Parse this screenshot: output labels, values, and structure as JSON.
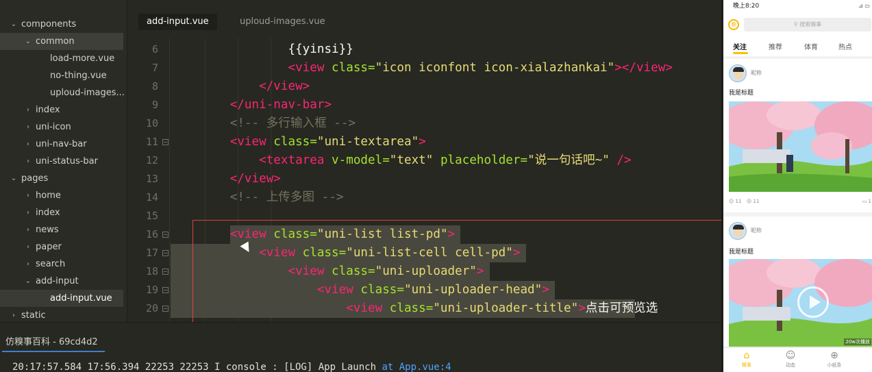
{
  "sidebar": {
    "items": [
      {
        "label": "components",
        "level": 0,
        "expanded": true
      },
      {
        "label": "common",
        "level": 1,
        "expanded": true,
        "highlighted": true
      },
      {
        "label": "load-more.vue",
        "level": 2,
        "file": true
      },
      {
        "label": "no-thing.vue",
        "level": 2,
        "file": true
      },
      {
        "label": "uploud-images...",
        "level": 2,
        "file": true
      },
      {
        "label": "index",
        "level": 1,
        "expanded": false
      },
      {
        "label": "uni-icon",
        "level": 1,
        "expanded": false
      },
      {
        "label": "uni-nav-bar",
        "level": 1,
        "expanded": false
      },
      {
        "label": "uni-status-bar",
        "level": 1,
        "expanded": false
      },
      {
        "label": "pages",
        "level": 0,
        "expanded": true
      },
      {
        "label": "home",
        "level": 1,
        "expanded": false
      },
      {
        "label": "index",
        "level": 1,
        "expanded": false
      },
      {
        "label": "news",
        "level": 1,
        "expanded": false
      },
      {
        "label": "paper",
        "level": 1,
        "expanded": false
      },
      {
        "label": "search",
        "level": 1,
        "expanded": false
      },
      {
        "label": "add-input",
        "level": 1,
        "expanded": true
      },
      {
        "label": "add-input.vue",
        "level": 2,
        "file": true,
        "current": true
      },
      {
        "label": "static",
        "level": 0,
        "expanded": false
      }
    ]
  },
  "tabs": [
    {
      "label": "add-input.vue",
      "active": true
    },
    {
      "label": "uploud-images.vue",
      "active": false
    }
  ],
  "editor": {
    "lines": [
      {
        "num": "6",
        "fold": false,
        "tokens": [
          {
            "t": "txt",
            "v": "                {{yinsi}}"
          }
        ]
      },
      {
        "num": "7",
        "fold": false,
        "tokens": [
          {
            "t": "txt",
            "v": "                "
          },
          {
            "t": "tag",
            "v": "<view"
          },
          {
            "t": "attr",
            "v": " class="
          },
          {
            "t": "str",
            "v": "\"icon iconfont icon-xialazhankai\""
          },
          {
            "t": "tag",
            "v": "></view>"
          }
        ]
      },
      {
        "num": "8",
        "fold": false,
        "tokens": [
          {
            "t": "txt",
            "v": "            "
          },
          {
            "t": "tag",
            "v": "</view>"
          }
        ]
      },
      {
        "num": "9",
        "fold": false,
        "tokens": [
          {
            "t": "txt",
            "v": "        "
          },
          {
            "t": "tag",
            "v": "</uni-nav-bar>"
          }
        ]
      },
      {
        "num": "10",
        "fold": false,
        "tokens": [
          {
            "t": "txt",
            "v": "        "
          },
          {
            "t": "com",
            "v": "<!-- 多行输入框 -->"
          }
        ]
      },
      {
        "num": "11",
        "fold": true,
        "tokens": [
          {
            "t": "txt",
            "v": "        "
          },
          {
            "t": "tag",
            "v": "<view"
          },
          {
            "t": "attr",
            "v": " class="
          },
          {
            "t": "str",
            "v": "\"uni-textarea\""
          },
          {
            "t": "tag",
            "v": ">"
          }
        ]
      },
      {
        "num": "12",
        "fold": false,
        "tokens": [
          {
            "t": "txt",
            "v": "            "
          },
          {
            "t": "tag",
            "v": "<textarea"
          },
          {
            "t": "attr",
            "v": " v-model="
          },
          {
            "t": "str",
            "v": "\"text\""
          },
          {
            "t": "attr",
            "v": " placeholder="
          },
          {
            "t": "str",
            "v": "\"说一句话吧~\""
          },
          {
            "t": "tag",
            "v": " />"
          }
        ]
      },
      {
        "num": "13",
        "fold": false,
        "tokens": [
          {
            "t": "txt",
            "v": "        "
          },
          {
            "t": "tag",
            "v": "</view>"
          }
        ]
      },
      {
        "num": "14",
        "fold": false,
        "tokens": [
          {
            "t": "txt",
            "v": "        "
          },
          {
            "t": "com",
            "v": "<!-- 上传多图 -->"
          }
        ]
      },
      {
        "num": "15",
        "fold": false,
        "tokens": [
          {
            "t": "txt",
            "v": ""
          }
        ]
      },
      {
        "num": "16",
        "fold": true,
        "tokens": [
          {
            "t": "txt",
            "v": "        "
          },
          {
            "t": "tag",
            "v": "<view"
          },
          {
            "t": "attr",
            "v": " class="
          },
          {
            "t": "str",
            "v": "\"uni-list list-pd\""
          },
          {
            "t": "tag",
            "v": ">"
          }
        ]
      },
      {
        "num": "17",
        "fold": true,
        "tokens": [
          {
            "t": "txt",
            "v": "            "
          },
          {
            "t": "tag",
            "v": "<view"
          },
          {
            "t": "attr",
            "v": " class="
          },
          {
            "t": "str",
            "v": "\"uni-list-cell cell-pd\""
          },
          {
            "t": "tag",
            "v": ">"
          }
        ]
      },
      {
        "num": "18",
        "fold": true,
        "tokens": [
          {
            "t": "txt",
            "v": "                "
          },
          {
            "t": "tag",
            "v": "<view"
          },
          {
            "t": "attr",
            "v": " class="
          },
          {
            "t": "str",
            "v": "\"uni-uploader\""
          },
          {
            "t": "tag",
            "v": ">"
          }
        ]
      },
      {
        "num": "19",
        "fold": true,
        "tokens": [
          {
            "t": "txt",
            "v": "                    "
          },
          {
            "t": "tag",
            "v": "<view"
          },
          {
            "t": "attr",
            "v": " class="
          },
          {
            "t": "str",
            "v": "\"uni-uploader-head\""
          },
          {
            "t": "tag",
            "v": ">"
          }
        ]
      },
      {
        "num": "20",
        "fold": true,
        "tokens": [
          {
            "t": "txt",
            "v": "                        "
          },
          {
            "t": "tag",
            "v": "<view"
          },
          {
            "t": "attr",
            "v": " class="
          },
          {
            "t": "str",
            "v": "\"uni-uploader-title\""
          },
          {
            "t": "tag",
            "v": ">"
          },
          {
            "t": "txt",
            "v": "点击可预览选"
          }
        ]
      }
    ]
  },
  "console": {
    "tab_label": "仿糗事百科 - 69cd4d2",
    "log_prefix": "20:17:57.584 17:56.394 22253 22253 I console : [LOG] App Launch ",
    "log_link": "at App.vue:4"
  },
  "phone": {
    "status_time": "晚上8:20",
    "status_right": "⊿ ▭",
    "nav_icon": "糗",
    "search_placeholder": "⚲ 搜索糗事",
    "tabs": [
      {
        "label": "关注",
        "active": true
      },
      {
        "label": "推荐",
        "active": false
      },
      {
        "label": "体育",
        "active": false
      },
      {
        "label": "热点",
        "active": false
      }
    ],
    "posts": [
      {
        "nick": "昵称",
        "title": "我是标题",
        "likes": "☺ 11",
        "dislikes": "☹ 11",
        "comments": "▭ 1",
        "video": false
      },
      {
        "nick": "昵称",
        "title": "我是标题",
        "duration": "20w次播放",
        "video": true
      }
    ],
    "bottom_nav": [
      {
        "label": "糗事",
        "icon": "⌂",
        "active": true
      },
      {
        "label": "动态",
        "icon": "☺",
        "active": false
      },
      {
        "label": "小纸条",
        "icon": "⊕",
        "active": false
      }
    ]
  }
}
